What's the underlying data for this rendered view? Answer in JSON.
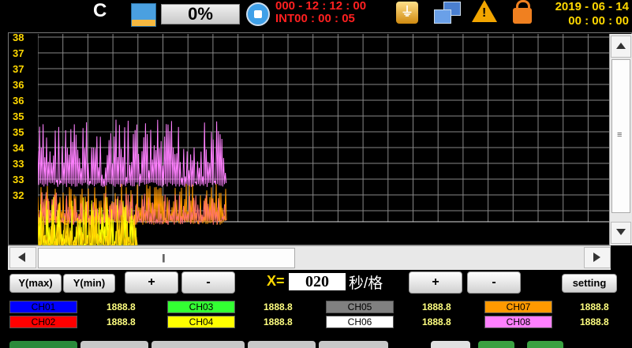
{
  "topbar": {
    "logo": "C",
    "progress": "0%",
    "timer_main": "000 - 12 : 12 : 00",
    "timer_interval": "INT00 : 00 : 05",
    "date": "2019 - 06 - 14",
    "time": "00 : 00 : 00",
    "usb_icon": "usb-icon",
    "network_icon": "network-icon",
    "warning_icon": "warning-icon",
    "lock_icon": "lock-icon",
    "colors": {
      "timer": "#ff2020",
      "date": "#ffd800"
    }
  },
  "chart": {
    "y_ticks": [
      "38",
      "37",
      "37",
      "36",
      "36",
      "35",
      "35",
      "34",
      "33",
      "33",
      "32"
    ],
    "grid_color": "#888888",
    "tick_color": "#ffd800"
  },
  "controls": {
    "ymax": "Y(max)",
    "ymin": "Y(min)",
    "plus": "+",
    "minus": "-",
    "x_label": "X=",
    "x_value": "020",
    "x_unit": "秒/格",
    "setting": "setting"
  },
  "channels": [
    {
      "name": "CH01",
      "value": "1888.8",
      "color": "#0000ff",
      "text": "#000000"
    },
    {
      "name": "CH02",
      "value": "1888.8",
      "color": "#ff0000",
      "text": "#000000"
    },
    {
      "name": "CH03",
      "value": "1888.8",
      "color": "#33ff33",
      "text": "#000000"
    },
    {
      "name": "CH04",
      "value": "1888.8",
      "color": "#ffff00",
      "text": "#000000"
    },
    {
      "name": "CH05",
      "value": "1888.8",
      "color": "#808080",
      "text": "#000000"
    },
    {
      "name": "CH06",
      "value": "1888.8",
      "color": "#ffffff",
      "text": "#000000"
    },
    {
      "name": "CH07",
      "value": "1888.8",
      "color": "#ff9900",
      "text": "#000000"
    },
    {
      "name": "CH08",
      "value": "1888.8",
      "color": "#ff80ff",
      "text": "#000000"
    }
  ]
}
